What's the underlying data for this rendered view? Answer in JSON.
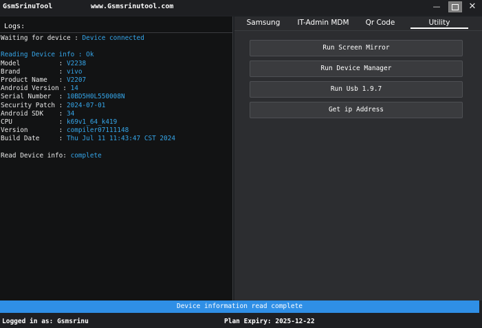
{
  "window": {
    "title": "GsmSrinuTool",
    "url": "www.Gsmsrinutool.com",
    "minimize_glyph": "—",
    "close_glyph": "✕"
  },
  "logs": {
    "header": "Logs:",
    "lines": [
      [
        {
          "t": "Waiting for device : ",
          "c": "w"
        },
        {
          "t": "Device connected",
          "c": "b"
        }
      ],
      [],
      [
        {
          "t": "Reading Device info : Ok",
          "c": "b"
        }
      ],
      [
        {
          "t": "Model          : ",
          "c": "w"
        },
        {
          "t": "V2238",
          "c": "b"
        }
      ],
      [
        {
          "t": "Brand          : ",
          "c": "w"
        },
        {
          "t": "vivo",
          "c": "b"
        }
      ],
      [
        {
          "t": "Product Name   : ",
          "c": "w"
        },
        {
          "t": "V2207",
          "c": "b"
        }
      ],
      [
        {
          "t": "Android Version : ",
          "c": "w"
        },
        {
          "t": "14",
          "c": "b"
        }
      ],
      [
        {
          "t": "Serial Number  : ",
          "c": "w"
        },
        {
          "t": "10BD5H0L550008N",
          "c": "b"
        }
      ],
      [
        {
          "t": "Security Patch : ",
          "c": "w"
        },
        {
          "t": "2024-07-01",
          "c": "b"
        }
      ],
      [
        {
          "t": "Android SDK    : ",
          "c": "w"
        },
        {
          "t": "34",
          "c": "b"
        }
      ],
      [
        {
          "t": "CPU            : ",
          "c": "w"
        },
        {
          "t": "k69v1_64_k419",
          "c": "b"
        }
      ],
      [
        {
          "t": "Version        : ",
          "c": "w"
        },
        {
          "t": "compiler07111148",
          "c": "b"
        }
      ],
      [
        {
          "t": "Build Date     : ",
          "c": "w"
        },
        {
          "t": "Thu Jul 11 11:43:47 CST 2024",
          "c": "b"
        }
      ],
      [],
      [
        {
          "t": "Read Device info: ",
          "c": "w"
        },
        {
          "t": "complete",
          "c": "b"
        }
      ]
    ]
  },
  "tabs": [
    {
      "label": "Samsung"
    },
    {
      "label": "IT-Admin MDM"
    },
    {
      "label": "Qr Code"
    },
    {
      "label": "Utility"
    }
  ],
  "utility": {
    "buttons": [
      {
        "label": "Run Screen Mirror"
      },
      {
        "label": "Run Device Manager"
      },
      {
        "label": "Run Usb 1.9.7"
      },
      {
        "label": "Get ip Address"
      }
    ]
  },
  "status": {
    "text": "Device information read complete"
  },
  "footer": {
    "logged_in": "Logged in as: Gsmsrinu",
    "plan_expiry": "Plan Expiry: 2025-12-22"
  },
  "colors": {
    "accent": "#2f8fe6",
    "log_value": "#35a6ea",
    "background": "#1f2124"
  },
  "icons": {
    "minimize": "minimize-icon",
    "maximize": "maximize-icon",
    "close": "close-icon"
  }
}
